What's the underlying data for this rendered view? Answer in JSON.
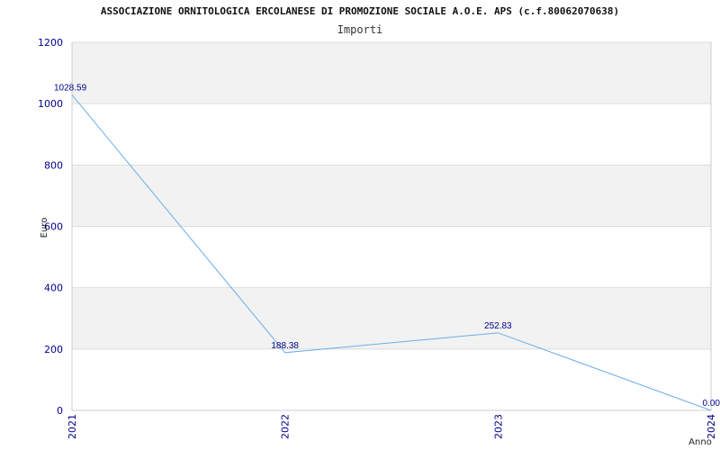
{
  "chart_data": {
    "type": "line",
    "title": "ASSOCIAZIONE ORNITOLOGICA ERCOLANESE DI PROMOZIONE SOCIALE A.O.E. APS (c.f.80062070638)",
    "subtitle": "Importi",
    "xlabel": "Anno",
    "ylabel": "Euro",
    "categories": [
      "2021",
      "2022",
      "2023",
      "2024"
    ],
    "values": [
      1028.59,
      188.38,
      252.83,
      0.0
    ],
    "data_labels": [
      "1028.59",
      "188.38",
      "252.83",
      "0.00"
    ],
    "ylim": [
      0,
      1200
    ],
    "yticks": [
      "0",
      "200",
      "400",
      "600",
      "800",
      "1000",
      "1200"
    ],
    "grid": true,
    "line_color": "#6aaee8",
    "band_color": "#f2f2f2",
    "tick_color": "#00008b"
  }
}
